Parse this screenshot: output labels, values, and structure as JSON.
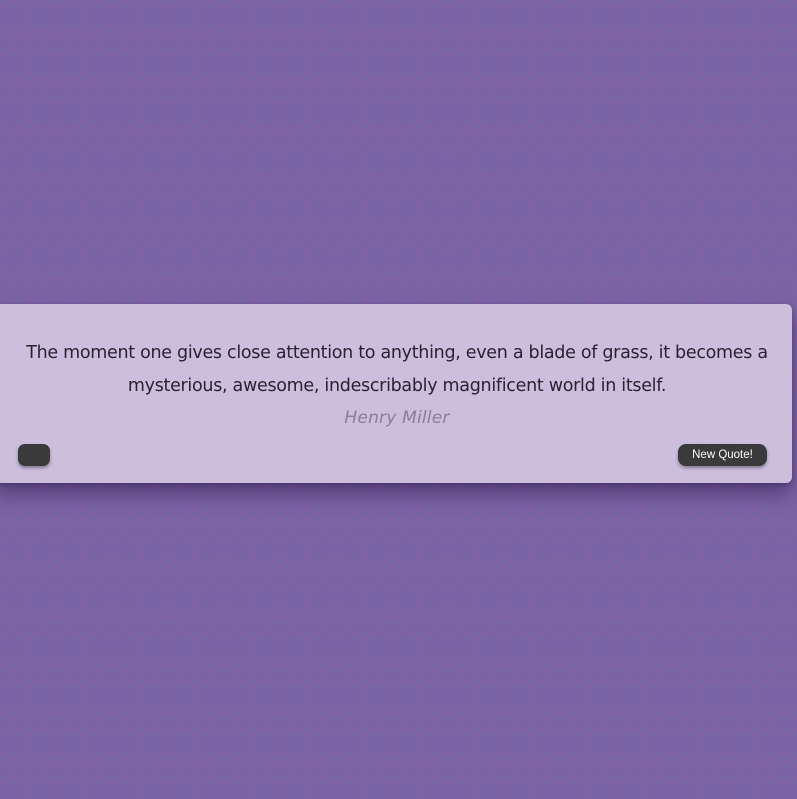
{
  "background": {
    "base_color": "#7b64a6",
    "pattern": "hexagon-grid",
    "pattern_color": "#8a5ea0"
  },
  "quote": {
    "text": "The moment one gives close attention to anything, even a blade of grass, it becomes a mysterious, awesome, indescribably magnificent world in itself.",
    "author": "Henry Miller"
  },
  "buttons": {
    "tweet_label": "",
    "new_quote_label": "New Quote!",
    "button_color": "#3a3a3a"
  }
}
